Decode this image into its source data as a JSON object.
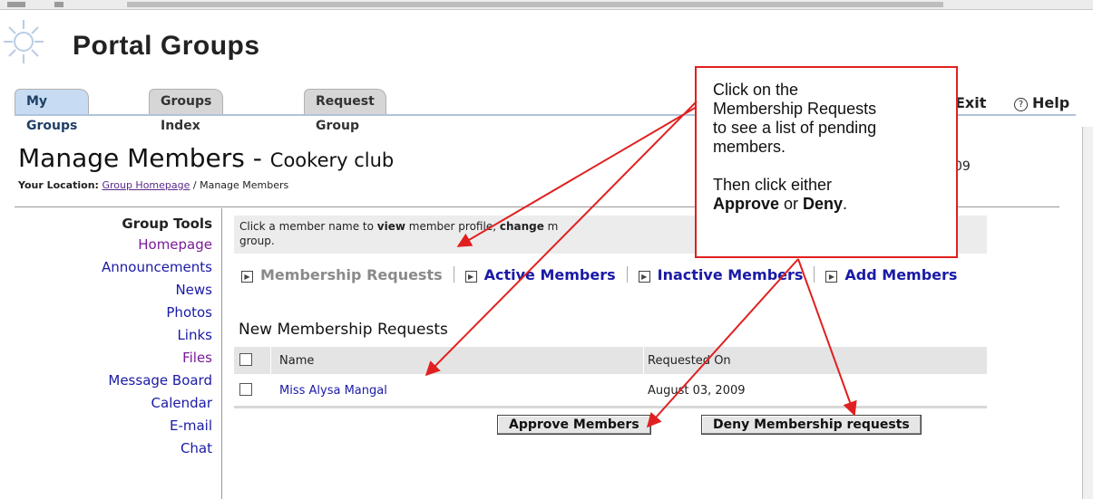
{
  "header": {
    "title": "Portal Groups"
  },
  "tabs": [
    {
      "label": "My Groups",
      "active": true
    },
    {
      "label": "Groups Index",
      "active": false
    },
    {
      "label": "Request Group",
      "active": false
    }
  ],
  "top_links": {
    "exit": "Exit",
    "help": "Help"
  },
  "page": {
    "title": "Manage Members",
    "separator": " - ",
    "group_name": "Cookery club",
    "date_fragment": "09"
  },
  "location": {
    "label": "Your Location:",
    "link": "Group Homepage",
    "separator": " / ",
    "current": "Manage Members"
  },
  "sidebar": {
    "title": "Group Tools",
    "items": [
      {
        "label": "Homepage",
        "visited": true
      },
      {
        "label": "Announcements",
        "visited": false
      },
      {
        "label": "News",
        "visited": false
      },
      {
        "label": "Photos",
        "visited": false
      },
      {
        "label": "Links",
        "visited": false
      },
      {
        "label": "Files",
        "visited": true
      },
      {
        "label": "Message Board",
        "visited": false
      },
      {
        "label": "Calendar",
        "visited": false
      },
      {
        "label": "E-mail",
        "visited": false
      },
      {
        "label": "Chat",
        "visited": false
      }
    ]
  },
  "info": {
    "p1": "Click a member name to ",
    "b1": "view",
    "p2": " member profile, ",
    "b2": "change",
    "p3": " m",
    "line2": "group."
  },
  "member_nav": [
    {
      "label": "Membership Requests",
      "current": true
    },
    {
      "label": "Active Members",
      "current": false
    },
    {
      "label": "Inactive Members",
      "current": false
    },
    {
      "label": "Add Members",
      "current": false
    }
  ],
  "requests": {
    "title": "New Membership Requests",
    "columns": [
      "Name",
      "Requested On"
    ],
    "rows": [
      {
        "name": "Miss Alysa Mangal",
        "date": "August 03, 2009"
      }
    ],
    "approve_label": "Approve Members",
    "deny_label": "Deny Membership requests"
  },
  "callout": {
    "line1": "Click on the",
    "line2": "Membership Requests",
    "line3": "to see a list of pending",
    "line4": "members.",
    "line5": "Then click either",
    "approve": "Approve",
    "or": " or ",
    "deny": "Deny",
    "end": "."
  },
  "colors": {
    "callout_border": "#e02020",
    "link": "#1a1aa6",
    "visited": "#7a1a9a",
    "active_tab": "#c7dcf2"
  }
}
